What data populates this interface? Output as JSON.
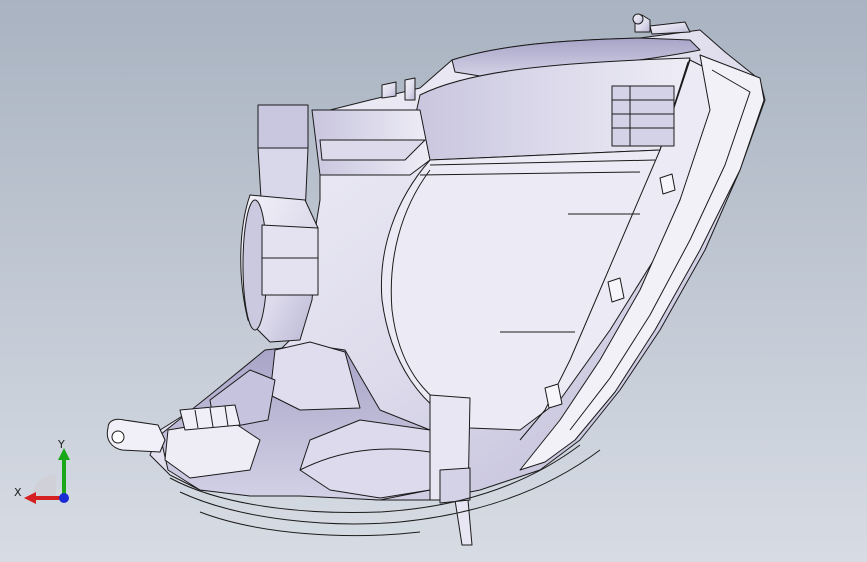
{
  "viewport": {
    "background_top": "#a9b3c1",
    "background_bottom": "#d7dce4",
    "model_name": "headlamp-assembly-3d-model"
  },
  "triad": {
    "x_label": "X",
    "y_label": "Y",
    "x_color": "#d42020",
    "y_color": "#1aa81a",
    "z_color": "#1a2ad4"
  },
  "colors": {
    "body_fill": "#e9e8f2",
    "body_shadow": "#b9b6d4",
    "edge": "#1b1b1b"
  }
}
